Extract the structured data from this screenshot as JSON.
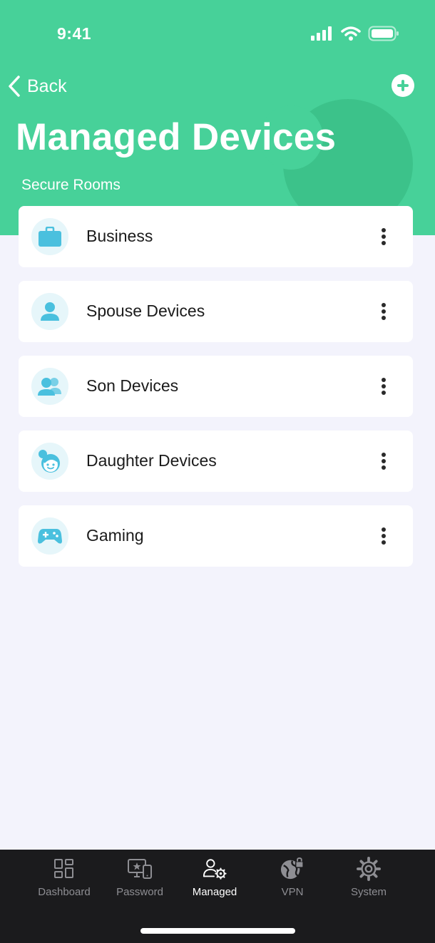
{
  "status_bar": {
    "time": "9:41",
    "icons": [
      "cellular-signal-icon",
      "wifi-icon",
      "battery-icon"
    ]
  },
  "header": {
    "back_label": "Back",
    "back_icon": "chevron-left-icon",
    "add_icon": "plus-circle-icon",
    "title": "Managed Devices",
    "section_label": "Secure Rooms",
    "background_color": "#47d199"
  },
  "rooms": [
    {
      "name": "Business",
      "icon": "briefcase-icon"
    },
    {
      "name": "Spouse Devices",
      "icon": "person-icon"
    },
    {
      "name": "Son Devices",
      "icon": "people-icon"
    },
    {
      "name": "Daughter Devices",
      "icon": "girl-face-icon"
    },
    {
      "name": "Gaming",
      "icon": "gamepad-icon"
    }
  ],
  "room_icon_color": "#4ac0de",
  "tabbar": {
    "tabs": [
      {
        "label": "Dashboard",
        "icon": "dashboard-grid-icon",
        "active": false
      },
      {
        "label": "Password",
        "icon": "password-devices-icon",
        "active": false
      },
      {
        "label": "Managed",
        "icon": "managed-user-gear-icon",
        "active": true
      },
      {
        "label": "VPN",
        "icon": "globe-lock-icon",
        "active": false
      },
      {
        "label": "System",
        "icon": "gear-icon",
        "active": false
      }
    ]
  }
}
